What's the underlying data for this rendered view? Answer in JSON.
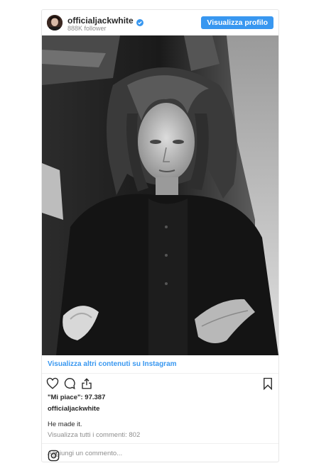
{
  "header": {
    "username": "officialjackwhite",
    "followers": "888K follower",
    "profile_button": "Visualizza profilo",
    "avatar_icon": "avatar-photo",
    "verified_icon": "verified-badge-icon"
  },
  "post": {
    "more_content_link": "Visualizza altri contenuti su Instagram",
    "likes": "\"Mi piace\": 97.387",
    "owner": "officialjackwhite",
    "caption": "He made it.",
    "view_comments": "Visualizza tutti i commenti: 802",
    "add_comment_placeholder": "Aggiungi un commento...",
    "action_icons": [
      "heart-icon",
      "comment-icon",
      "share-icon",
      "bookmark-icon",
      "instagram-icon"
    ]
  },
  "colors": {
    "accent": "#3897f0",
    "text": "#262626",
    "muted": "#8e8e8e",
    "border": "#efefef"
  }
}
